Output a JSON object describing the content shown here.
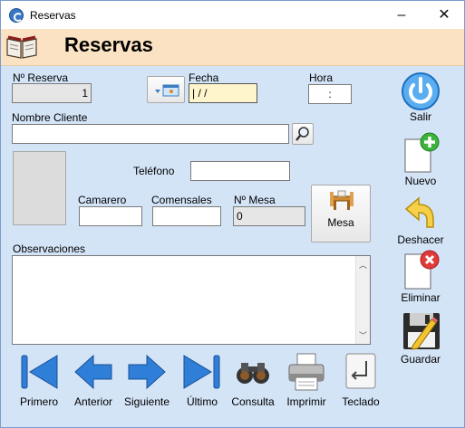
{
  "window": {
    "title": "Reservas",
    "minimize": "–",
    "close": "✕"
  },
  "header": {
    "title": "Reservas",
    "icon": "open-book-icon"
  },
  "form": {
    "reserva_label": "Nº Reserva",
    "reserva_value": "1",
    "fecha_label": "Fecha",
    "fecha_value": "| /  /",
    "hora_label": "Hora",
    "hora_value": ":",
    "nombre_label": "Nombre Cliente",
    "nombre_value": "",
    "telefono_label": "Teléfono",
    "telefono_value": "",
    "camarero_label": "Camarero",
    "camarero_value": "",
    "comensales_label": "Comensales",
    "comensales_value": "",
    "mesa_label": "Nº Mesa",
    "mesa_value": "0",
    "mesa_button": "Mesa",
    "observaciones_label": "Observaciones",
    "observaciones_value": ""
  },
  "side_buttons": {
    "salir": "Salir",
    "nuevo": "Nuevo",
    "deshacer": "Deshacer",
    "eliminar": "Eliminar",
    "guardar": "Guardar"
  },
  "nav_buttons": {
    "primero": "Primero",
    "anterior": "Anterior",
    "siguiente": "Siguiente",
    "ultimo": "Último",
    "consulta": "Consulta",
    "imprimir": "Imprimir",
    "teclado": "Teclado"
  },
  "colors": {
    "background": "#d4e4f7",
    "header": "#fbe2c2",
    "nav_blue": "#2f7fd8",
    "date_highlight": "#fff5cc"
  }
}
